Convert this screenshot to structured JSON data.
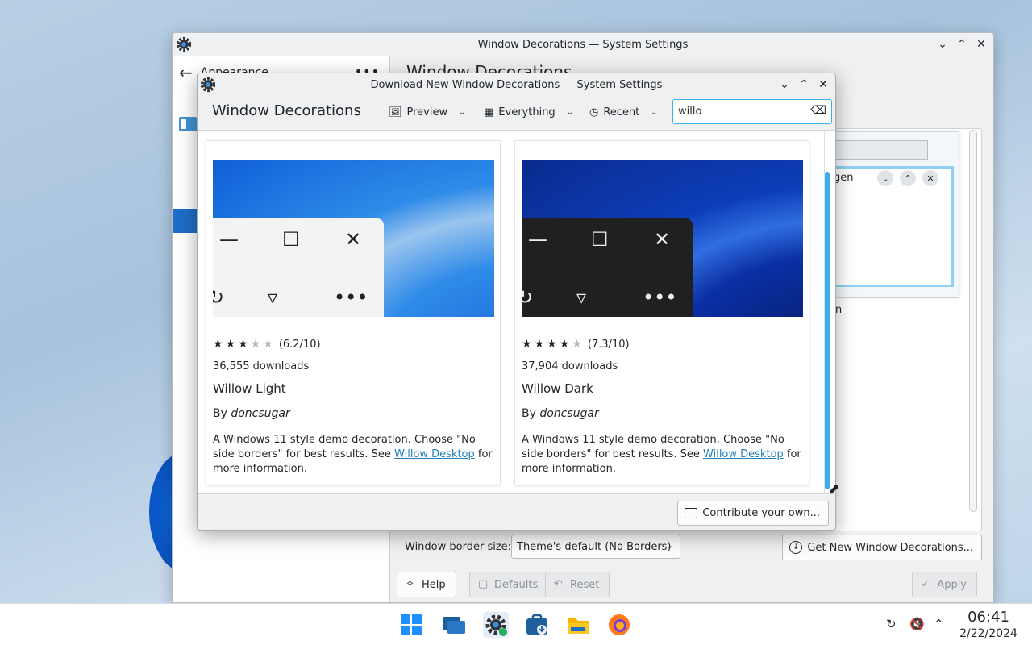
{
  "main_window": {
    "title": "Window Decorations — System Settings",
    "sidebar_back_label": "Appearance",
    "content_title": "Window Decorations",
    "preview_label": "gen",
    "preview_label_2": "n",
    "border_size_label": "Window border size:",
    "border_size_value": "Theme's default (No Borders)",
    "get_new_label": "Get New Window Decorations...",
    "help_label": "Help",
    "defaults_label": "Defaults",
    "reset_label": "Reset",
    "apply_label": "Apply"
  },
  "dialog": {
    "title": "Download New Window Decorations — System Settings",
    "heading": "Window Decorations",
    "view_mode": "Preview",
    "filter": "Everything",
    "sort": "Recent",
    "search_value": "willo",
    "contribute_label": "Contribute your own...",
    "items": [
      {
        "rating_stars": 3,
        "score": "(6.2/10)",
        "downloads": "36,555 downloads",
        "name": "Willow Light",
        "by": "By",
        "author": "doncsugar",
        "desc_pre": "A Windows 11 style demo decoration. Choose \"No side borders\" for best results. See ",
        "link": "Willow Desktop",
        "desc_post": " for more information.",
        "theme": "light"
      },
      {
        "rating_stars": 4,
        "score": "(7.3/10)",
        "downloads": "37,904 downloads",
        "name": "Willow Dark",
        "by": "By",
        "author": "doncsugar",
        "desc_pre": "A Windows 11 style demo decoration. Choose \"No side borders\" for best results. See ",
        "link": "Willow Desktop",
        "desc_post": " for more information.",
        "theme": "dark"
      }
    ]
  },
  "taskbar": {
    "apps": [
      "start-menu-icon",
      "task-switcher-icon",
      "system-settings-icon",
      "discover-icon",
      "file-manager-icon",
      "firefox-icon"
    ],
    "time": "06:41",
    "date": "2/22/2024"
  },
  "colors": {
    "accent": "#3daee9",
    "link": "#2980b9",
    "selection": "#1e6ec8"
  }
}
